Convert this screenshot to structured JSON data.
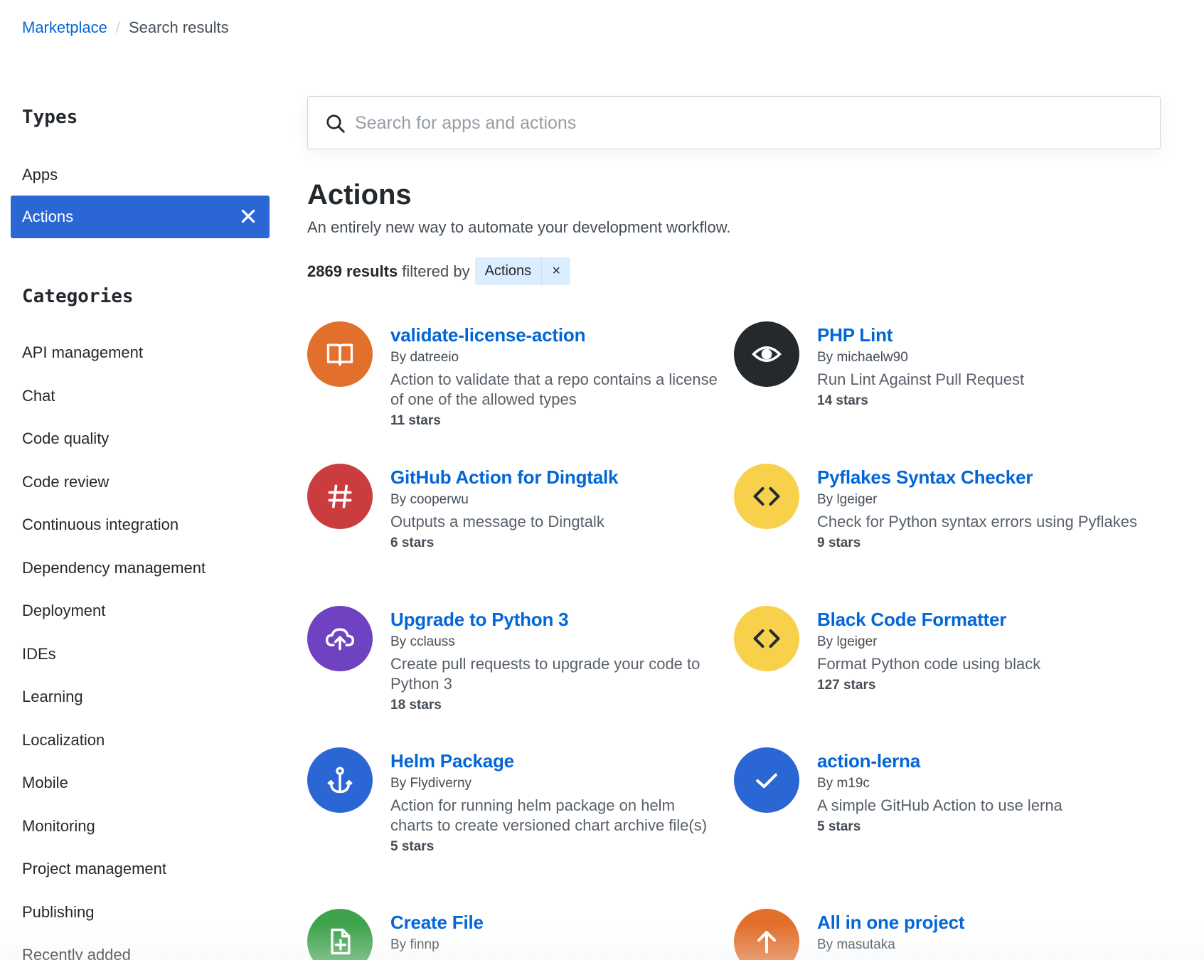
{
  "breadcrumb": {
    "root": "Marketplace",
    "separator": "/",
    "current": "Search results"
  },
  "sidebar": {
    "types_heading": "Types",
    "types": [
      {
        "label": "Apps",
        "selected": false
      },
      {
        "label": "Actions",
        "selected": true
      }
    ],
    "categories_heading": "Categories",
    "categories": [
      "API management",
      "Chat",
      "Code quality",
      "Code review",
      "Continuous integration",
      "Dependency management",
      "Deployment",
      "IDEs",
      "Learning",
      "Localization",
      "Mobile",
      "Monitoring",
      "Project management",
      "Publishing",
      "Recently added"
    ]
  },
  "search": {
    "placeholder": "Search for apps and actions",
    "value": ""
  },
  "main": {
    "title": "Actions",
    "subtitle": "An entirely new way to automate your development workflow.",
    "results_count": "2869 results",
    "filtered_by": "filtered by",
    "filter_chip": "Actions",
    "filter_chip_close": "×"
  },
  "colors": {
    "accent": "#2a66d4",
    "link": "#0366d6",
    "chip_bg": "#dbedff"
  },
  "cards": [
    {
      "title": "validate-license-action",
      "author": "By datreeio",
      "desc": "Action to validate that a repo contains a license of one of the allowed types",
      "stars": "11 stars",
      "icon": "book-icon",
      "color": "#e36f2c"
    },
    {
      "title": "PHP Lint",
      "author": "By michaelw90",
      "desc": "Run Lint Against Pull Request",
      "stars": "14 stars",
      "icon": "eye-icon",
      "color": "#24292e"
    },
    {
      "title": "GitHub Action for Dingtalk",
      "author": "By cooperwu",
      "desc": "Outputs a message to Dingtalk",
      "stars": "6 stars",
      "icon": "hash-icon",
      "color": "#cb3c3f"
    },
    {
      "title": "Pyflakes Syntax Checker",
      "author": "By lgeiger",
      "desc": "Check for Python syntax errors using Pyflakes",
      "stars": "9 stars",
      "icon": "code-icon",
      "color": "#f7d14c"
    },
    {
      "title": "Upgrade to Python 3",
      "author": "By cclauss",
      "desc": "Create pull requests to upgrade your code to Python 3",
      "stars": "18 stars",
      "icon": "cloud-upload-icon",
      "color": "#6f42c1"
    },
    {
      "title": "Black Code Formatter",
      "author": "By lgeiger",
      "desc": "Format Python code using black",
      "stars": "127 stars",
      "icon": "code-icon",
      "color": "#f7d14c"
    },
    {
      "title": "Helm Package",
      "author": "By Flydiverny",
      "desc": "Action for running helm package on helm charts to create versioned chart archive file(s)",
      "stars": "5 stars",
      "icon": "anchor-icon",
      "color": "#2a66d4"
    },
    {
      "title": "action-lerna",
      "author": "By m19c",
      "desc": "A simple GitHub Action to use lerna",
      "stars": "5 stars",
      "icon": "check-icon",
      "color": "#2a66d4"
    },
    {
      "title": "Create File",
      "author": "By finnp",
      "desc": "",
      "stars": "",
      "icon": "file-add-icon",
      "color": "#3fa34d"
    },
    {
      "title": "All in one project",
      "author": "By masutaka",
      "desc": "",
      "stars": "",
      "icon": "arrow-up-icon",
      "color": "#e36f2c"
    }
  ]
}
